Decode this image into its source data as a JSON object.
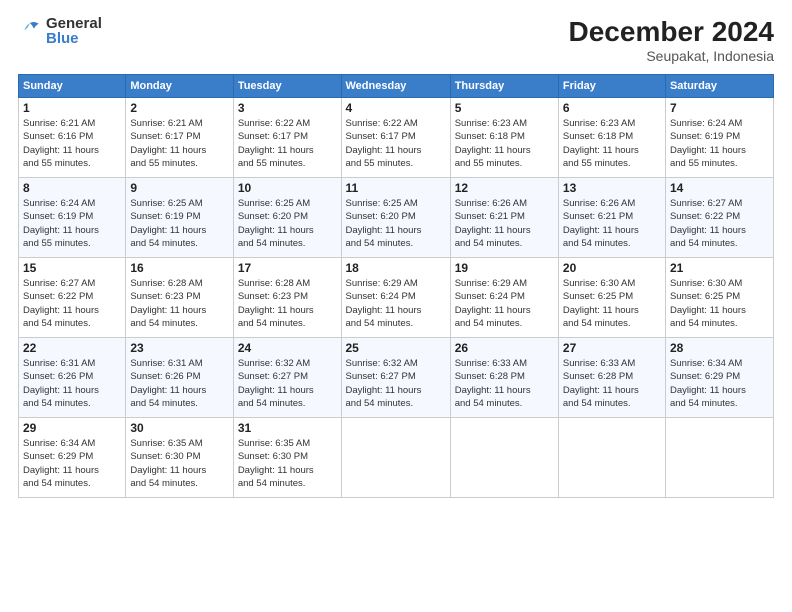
{
  "logo": {
    "general": "General",
    "blue": "Blue"
  },
  "title": "December 2024",
  "subtitle": "Seupakat, Indonesia",
  "weekdays": [
    "Sunday",
    "Monday",
    "Tuesday",
    "Wednesday",
    "Thursday",
    "Friday",
    "Saturday"
  ],
  "weeks": [
    [
      {
        "day": 1,
        "info": "Sunrise: 6:21 AM\nSunset: 6:16 PM\nDaylight: 11 hours\nand 55 minutes."
      },
      {
        "day": 2,
        "info": "Sunrise: 6:21 AM\nSunset: 6:17 PM\nDaylight: 11 hours\nand 55 minutes."
      },
      {
        "day": 3,
        "info": "Sunrise: 6:22 AM\nSunset: 6:17 PM\nDaylight: 11 hours\nand 55 minutes."
      },
      {
        "day": 4,
        "info": "Sunrise: 6:22 AM\nSunset: 6:17 PM\nDaylight: 11 hours\nand 55 minutes."
      },
      {
        "day": 5,
        "info": "Sunrise: 6:23 AM\nSunset: 6:18 PM\nDaylight: 11 hours\nand 55 minutes."
      },
      {
        "day": 6,
        "info": "Sunrise: 6:23 AM\nSunset: 6:18 PM\nDaylight: 11 hours\nand 55 minutes."
      },
      {
        "day": 7,
        "info": "Sunrise: 6:24 AM\nSunset: 6:19 PM\nDaylight: 11 hours\nand 55 minutes."
      }
    ],
    [
      {
        "day": 8,
        "info": "Sunrise: 6:24 AM\nSunset: 6:19 PM\nDaylight: 11 hours\nand 55 minutes."
      },
      {
        "day": 9,
        "info": "Sunrise: 6:25 AM\nSunset: 6:19 PM\nDaylight: 11 hours\nand 54 minutes."
      },
      {
        "day": 10,
        "info": "Sunrise: 6:25 AM\nSunset: 6:20 PM\nDaylight: 11 hours\nand 54 minutes."
      },
      {
        "day": 11,
        "info": "Sunrise: 6:25 AM\nSunset: 6:20 PM\nDaylight: 11 hours\nand 54 minutes."
      },
      {
        "day": 12,
        "info": "Sunrise: 6:26 AM\nSunset: 6:21 PM\nDaylight: 11 hours\nand 54 minutes."
      },
      {
        "day": 13,
        "info": "Sunrise: 6:26 AM\nSunset: 6:21 PM\nDaylight: 11 hours\nand 54 minutes."
      },
      {
        "day": 14,
        "info": "Sunrise: 6:27 AM\nSunset: 6:22 PM\nDaylight: 11 hours\nand 54 minutes."
      }
    ],
    [
      {
        "day": 15,
        "info": "Sunrise: 6:27 AM\nSunset: 6:22 PM\nDaylight: 11 hours\nand 54 minutes."
      },
      {
        "day": 16,
        "info": "Sunrise: 6:28 AM\nSunset: 6:23 PM\nDaylight: 11 hours\nand 54 minutes."
      },
      {
        "day": 17,
        "info": "Sunrise: 6:28 AM\nSunset: 6:23 PM\nDaylight: 11 hours\nand 54 minutes."
      },
      {
        "day": 18,
        "info": "Sunrise: 6:29 AM\nSunset: 6:24 PM\nDaylight: 11 hours\nand 54 minutes."
      },
      {
        "day": 19,
        "info": "Sunrise: 6:29 AM\nSunset: 6:24 PM\nDaylight: 11 hours\nand 54 minutes."
      },
      {
        "day": 20,
        "info": "Sunrise: 6:30 AM\nSunset: 6:25 PM\nDaylight: 11 hours\nand 54 minutes."
      },
      {
        "day": 21,
        "info": "Sunrise: 6:30 AM\nSunset: 6:25 PM\nDaylight: 11 hours\nand 54 minutes."
      }
    ],
    [
      {
        "day": 22,
        "info": "Sunrise: 6:31 AM\nSunset: 6:26 PM\nDaylight: 11 hours\nand 54 minutes."
      },
      {
        "day": 23,
        "info": "Sunrise: 6:31 AM\nSunset: 6:26 PM\nDaylight: 11 hours\nand 54 minutes."
      },
      {
        "day": 24,
        "info": "Sunrise: 6:32 AM\nSunset: 6:27 PM\nDaylight: 11 hours\nand 54 minutes."
      },
      {
        "day": 25,
        "info": "Sunrise: 6:32 AM\nSunset: 6:27 PM\nDaylight: 11 hours\nand 54 minutes."
      },
      {
        "day": 26,
        "info": "Sunrise: 6:33 AM\nSunset: 6:28 PM\nDaylight: 11 hours\nand 54 minutes."
      },
      {
        "day": 27,
        "info": "Sunrise: 6:33 AM\nSunset: 6:28 PM\nDaylight: 11 hours\nand 54 minutes."
      },
      {
        "day": 28,
        "info": "Sunrise: 6:34 AM\nSunset: 6:29 PM\nDaylight: 11 hours\nand 54 minutes."
      }
    ],
    [
      {
        "day": 29,
        "info": "Sunrise: 6:34 AM\nSunset: 6:29 PM\nDaylight: 11 hours\nand 54 minutes."
      },
      {
        "day": 30,
        "info": "Sunrise: 6:35 AM\nSunset: 6:30 PM\nDaylight: 11 hours\nand 54 minutes."
      },
      {
        "day": 31,
        "info": "Sunrise: 6:35 AM\nSunset: 6:30 PM\nDaylight: 11 hours\nand 54 minutes."
      },
      null,
      null,
      null,
      null
    ]
  ]
}
